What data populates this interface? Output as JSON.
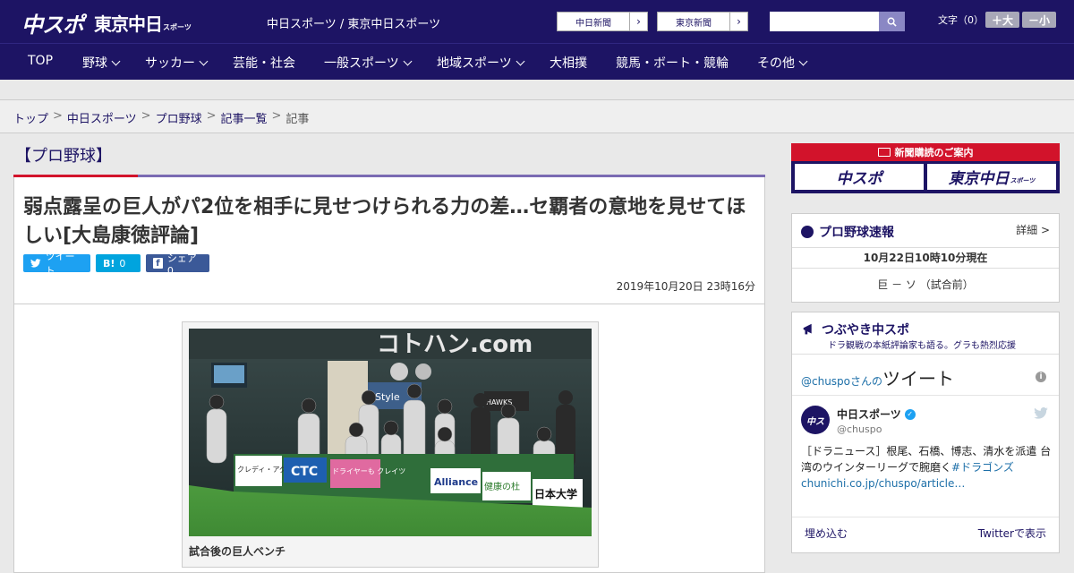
{
  "header": {
    "logo_main": "中スポ",
    "logo_sub": "東京中日",
    "logo_sub_small": "スポーツ",
    "site_title": "中日スポーツ / 東京中日スポーツ",
    "link1": "中日新聞",
    "link2": "東京新聞",
    "search_placeholder": "",
    "fontsize_label": "文字（0）",
    "font_plus": "＋大",
    "font_minus": "－小"
  },
  "nav": [
    {
      "label": "TOP"
    },
    {
      "label": "野球"
    },
    {
      "label": "サッカー"
    },
    {
      "label": "芸能・社会"
    },
    {
      "label": "一般スポーツ"
    },
    {
      "label": "地域スポーツ"
    },
    {
      "label": "大相撲"
    },
    {
      "label": "競馬・ボート・競輪"
    },
    {
      "label": "その他"
    }
  ],
  "breadcrumb": [
    "トップ",
    "中日スポーツ",
    "プロ野球",
    "記事一覧",
    "記事"
  ],
  "article": {
    "category": "【プロ野球】",
    "headline": "弱点露呈の巨人がパ2位を相手に見せつけられる力の差…セ覇者の意地を見せてほしい[大島康徳評論]",
    "tweet_label": "ツイート",
    "hatena_label": "0",
    "facebook_label": "シェア 0",
    "date": "2019年10月20日 23時16分",
    "photo_caption": "試合後の巨人ベンチ",
    "photo_text": {
      "banner": "コトハン.com",
      "ad1": "CTC",
      "ad2": "クレディ・アグリコル",
      "ad3": "ドライヤーも クレイツ",
      "ad4": "Alliance",
      "ad5": "健康の杜",
      "ad6": "日本大学",
      "ad7": "Style",
      "ad8": "HAWKS"
    }
  },
  "sidebar": {
    "promo_head": "新聞購読のご案内",
    "promo1": "中スポ",
    "promo2": "東京中日",
    "promo2_small": "スポーツ",
    "score_title": "プロ野球速報",
    "score_detail": "詳細 >",
    "score_time": "10月22日10時10分現在",
    "score_line": "巨 － ソ （試合前）",
    "tw_title": "つぶやき中スポ",
    "tw_sub": "ドラ観戦の本紙評論家も語る。グラも熱烈応援",
    "tw_handle_prefix": "@chuspoさんの",
    "tw_handle_suffix": "ツイート",
    "tw_name": "中日スポーツ",
    "tw_user": "@chuspo",
    "tw_text": "［ドラニュース］根尾、石橋、博志、清水を派遣 台湾のウインターリーグで腕磨く",
    "tw_tag": "#ドラゴンズ",
    "tw_link": "chunichi.co.jp/chuspo/article…",
    "tw_embed": "埋め込む",
    "tw_view": "Twitterで表示"
  },
  "colors": {
    "brand": "#1d1464",
    "accent_red": "#d2132b",
    "twitter": "#1da1f2",
    "hatena": "#00a4de",
    "facebook": "#3b5998"
  }
}
